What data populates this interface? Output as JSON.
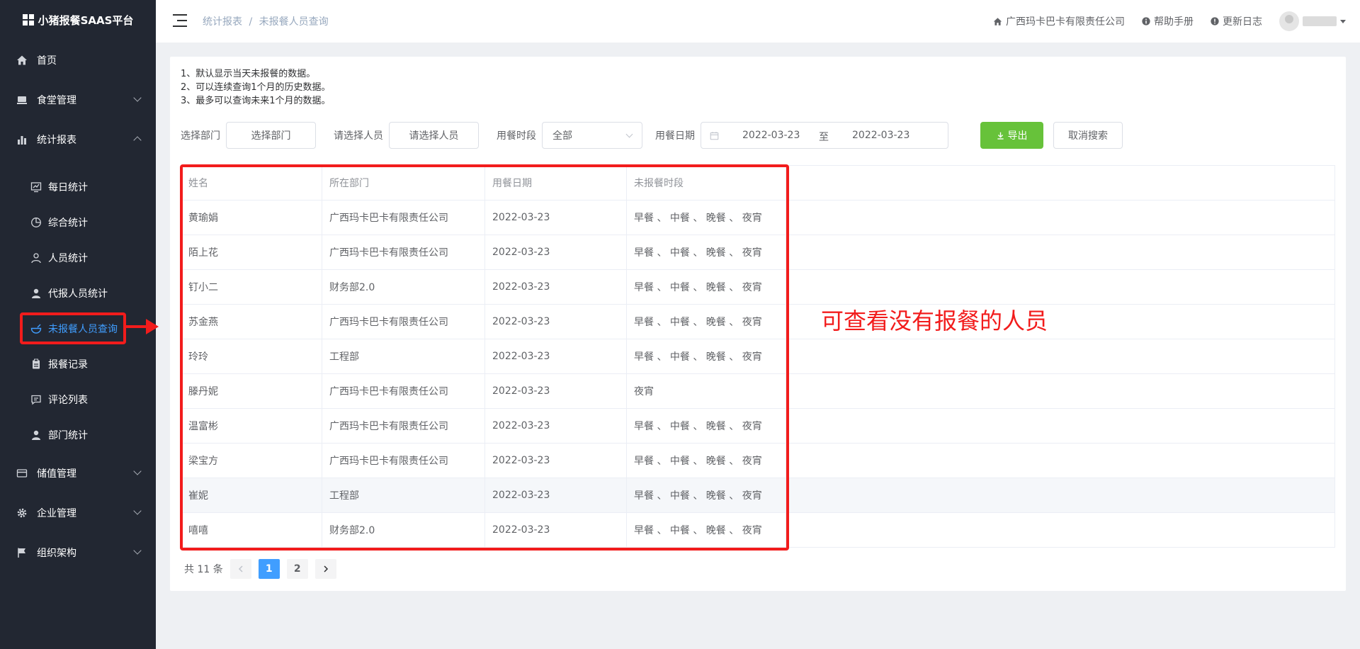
{
  "app": {
    "title": "小猪报餐SAAS平台"
  },
  "sidebar": {
    "menus": [
      {
        "label": "首页",
        "icon": "home-icon"
      },
      {
        "label": "食堂管理",
        "icon": "canteen-icon"
      },
      {
        "label": "统计报表",
        "icon": "bar-chart-icon"
      },
      {
        "label": "储值管理",
        "icon": "card-icon"
      },
      {
        "label": "企业管理",
        "icon": "gear-icon"
      },
      {
        "label": "组织架构",
        "icon": "flag-icon"
      }
    ],
    "submenu": [
      {
        "label": "每日统计",
        "icon": "daily-chart-icon"
      },
      {
        "label": "综合统计",
        "icon": "pie-icon"
      },
      {
        "label": "人员统计",
        "icon": "person-outline-icon"
      },
      {
        "label": "代报人员统计",
        "icon": "person-icon"
      },
      {
        "label": "未报餐人员查询",
        "icon": "bowl-icon"
      },
      {
        "label": "报餐记录",
        "icon": "clipboard-icon"
      },
      {
        "label": "评论列表",
        "icon": "comment-icon"
      },
      {
        "label": "部门统计",
        "icon": "person-icon"
      }
    ]
  },
  "header": {
    "breadcrumb": {
      "parent": "统计报表",
      "separator": "/",
      "current": "未报餐人员查询"
    },
    "company": "广西玛卡巴卡有限责任公司",
    "help": "帮助手册",
    "changelog": "更新日志"
  },
  "tips": [
    "1、默认显示当天未报餐的数据。",
    "2、可以连续查询1个月的历史数据。",
    "3、最多可以查询未来1个月的数据。"
  ],
  "filters": {
    "dept_label": "选择部门",
    "dept_value": "选择部门",
    "person_label": "请选择人员",
    "person_value": "请选择人员",
    "period_label": "用餐时段",
    "period_value": "全部",
    "date_label": "用餐日期",
    "date_start": "2022-03-23",
    "date_to": "至",
    "date_end": "2022-03-23",
    "export_label": "导出",
    "cancel_label": "取消搜索"
  },
  "table": {
    "headers": [
      "姓名",
      "所在部门",
      "用餐日期",
      "未报餐时段"
    ],
    "rows": [
      [
        "黄瑜娟",
        "广西玛卡巴卡有限责任公司",
        "2022-03-23",
        "早餐 、 中餐 、 晚餐 、 夜宵"
      ],
      [
        "陌上花",
        "广西玛卡巴卡有限责任公司",
        "2022-03-23",
        "早餐 、 中餐 、 晚餐 、 夜宵"
      ],
      [
        "钉小二",
        "财务部2.0",
        "2022-03-23",
        "早餐 、 中餐 、 晚餐 、 夜宵"
      ],
      [
        "苏金燕",
        "广西玛卡巴卡有限责任公司",
        "2022-03-23",
        "早餐 、 中餐 、 晚餐 、 夜宵"
      ],
      [
        "玲玲",
        "工程部",
        "2022-03-23",
        "早餐 、 中餐 、 晚餐 、 夜宵"
      ],
      [
        "滕丹妮",
        "广西玛卡巴卡有限责任公司",
        "2022-03-23",
        "夜宵"
      ],
      [
        "温富彬",
        "广西玛卡巴卡有限责任公司",
        "2022-03-23",
        "早餐 、 中餐 、 晚餐 、 夜宵"
      ],
      [
        "梁宝方",
        "广西玛卡巴卡有限责任公司",
        "2022-03-23",
        "早餐 、 中餐 、 晚餐 、 夜宵"
      ],
      [
        "崔妮",
        "工程部",
        "2022-03-23",
        "早餐 、 中餐 、 晚餐 、 夜宵"
      ],
      [
        "嘻嘻",
        "财务部2.0",
        "2022-03-23",
        "早餐 、 中餐 、 晚餐 、 夜宵"
      ]
    ]
  },
  "annotation": {
    "text": "可查看没有报餐的人员",
    "color": "#f21c1c"
  },
  "pagination": {
    "total": "共 11 条",
    "pages": [
      "1",
      "2"
    ],
    "current": "1"
  },
  "colors": {
    "sidebar_bg": "#222732",
    "accent": "#409eff",
    "export_green": "#67c23a"
  }
}
